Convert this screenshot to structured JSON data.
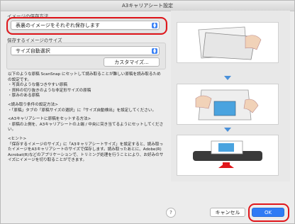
{
  "window": {
    "title": "A3キャリアシート設定"
  },
  "save_method": {
    "label": "イメージの保存方法",
    "selected": "表裏のイメージをそれぞれ保存します"
  },
  "image_size": {
    "label": "保存するイメージのサイズ",
    "selected": "サイズ自動選択",
    "customize_label": "カスタマイズ..."
  },
  "description": {
    "intro": "以下のような原稿 ScanSnap にセットして読み取ることが難しい原稿を読み取るための設定です。",
    "items": [
      "・写真のような傷つきやすい原稿",
      "・資料の切り抜きのような非定形サイズの原稿",
      "・厚みのある原稿"
    ],
    "read_settings_heading": "<読み取り条件の設定方法>",
    "read_settings_text": "・「原稿」タブの「原稿サイズの選択」に「サイズ自動検出」を設定してください。",
    "set_doc_heading": "<A3キャリアシートに原稿をセットする方法>",
    "set_doc_text": "・原稿の上側を、A3キャリアシートの上端 / 中央に突き当てるようにセットしてください。",
    "hint_heading": "<ヒント>",
    "hint_text": "「保存するイメージのサイズ」に「A3キャリアシートサイズ」を設定すると、読み取ったイメージをA3キャリアシートのサイズで保存します。読み取ったあとに、Adobe(R) Acrobat(R)などのアプリケーションで、トリミング処理を行うことにより、お好みのサイズにイメージを切り取ることができます。"
  },
  "help_label": "?",
  "buttons": {
    "cancel": "キャンセル",
    "ok": "OK"
  },
  "colors": {
    "accent": "#2f7bf5",
    "highlight": "#e0161b"
  }
}
